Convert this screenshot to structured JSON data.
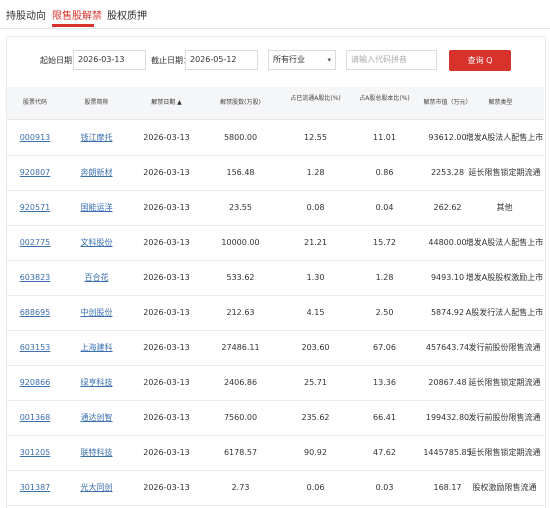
{
  "tabs": [
    "持股动向",
    "限售股解禁",
    "股权质押"
  ],
  "filters": {
    "start_label": "起始日期：",
    "start_value": "2026-03-13",
    "end_label": "截止日期：",
    "end_value": "2026-05-12",
    "industry": "所有行业",
    "search_placeholder": "请输入代码拼音",
    "query_button": "查询 Q"
  },
  "columns": [
    "股票代码",
    "股票简称",
    "解禁日期 ▲",
    "解禁股数(万股)",
    "占已流通A股比(%)",
    "占A股总股本比(%)",
    "解禁市值（万元）",
    "解禁类型"
  ],
  "rows": [
    [
      "000913",
      "钱江摩托",
      "2026-03-13",
      "5800.00",
      "12.55",
      "11.01",
      "93612.00",
      "增发A股法人配售上市"
    ],
    [
      "920807",
      "奔朗新材",
      "2026-03-13",
      "156.48",
      "1.28",
      "0.86",
      "2253.28",
      "延长限售锁定期流通"
    ],
    [
      "920571",
      "国能运洋",
      "2026-03-13",
      "23.55",
      "0.08",
      "0.04",
      "262.62",
      "其他"
    ],
    [
      "002775",
      "文科股份",
      "2026-03-13",
      "10000.00",
      "21.21",
      "15.72",
      "44800.00",
      "增发A股法人配售上市"
    ],
    [
      "603823",
      "百合花",
      "2026-03-13",
      "533.62",
      "1.30",
      "1.28",
      "9493.10",
      "增发A股股权激励上市"
    ],
    [
      "688695",
      "中创股份",
      "2026-03-13",
      "212.63",
      "4.15",
      "2.50",
      "5874.92",
      "A股发行法人配售上市"
    ],
    [
      "603153",
      "上海建科",
      "2026-03-13",
      "27486.11",
      "203.60",
      "67.06",
      "457643.74",
      "发行前股份限售流通"
    ],
    [
      "920866",
      "绿亨科技",
      "2026-03-13",
      "2406.86",
      "25.71",
      "13.36",
      "20867.48",
      "延长限售锁定期流通"
    ],
    [
      "001368",
      "通达创智",
      "2026-03-13",
      "7560.00",
      "235.62",
      "66.41",
      "199432.80",
      "发行前股份限售流通"
    ],
    [
      "301205",
      "联特科技",
      "2026-03-13",
      "6178.57",
      "90.92",
      "47.62",
      "1445785.85",
      "延长限售锁定期流通"
    ],
    [
      "301387",
      "光大同创",
      "2026-03-13",
      "2.73",
      "0.06",
      "0.03",
      "168.17",
      "股权激励限售流通"
    ]
  ]
}
